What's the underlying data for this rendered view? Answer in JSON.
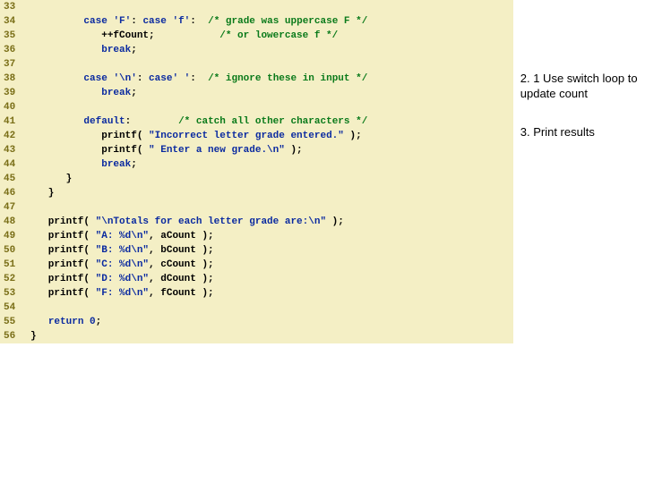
{
  "code_lines": [
    {
      "n": "33",
      "html": ""
    },
    {
      "n": "34",
      "html": "         <span class='kw'>case</span> <span class='ch'>'F'</span>: <span class='kw'>case</span> <span class='ch'>'f'</span>:  <span class='cm'>/* grade was uppercase F */</span>"
    },
    {
      "n": "35",
      "html": "            ++fCount;           <span class='cm'>/* or lowercase f */</span>"
    },
    {
      "n": "36",
      "html": "            <span class='kw'>break</span>;"
    },
    {
      "n": "37",
      "html": ""
    },
    {
      "n": "38",
      "html": "         <span class='kw'>case</span> <span class='ch'>'\\n'</span>: <span class='kw'>case</span><span class='ch'>' '</span>:  <span class='cm'>/* ignore these in input */</span>"
    },
    {
      "n": "39",
      "html": "            <span class='kw'>break</span>;"
    },
    {
      "n": "40",
      "html": ""
    },
    {
      "n": "41",
      "html": "         <span class='kw'>default</span>:        <span class='cm'>/* catch all other characters */</span>"
    },
    {
      "n": "42",
      "html": "            printf( <span class='str'>\"Incorrect letter grade entered.\"</span> );"
    },
    {
      "n": "43",
      "html": "            printf( <span class='str'>\" Enter a new grade.\\n\"</span> );"
    },
    {
      "n": "44",
      "html": "            <span class='kw'>break</span>;"
    },
    {
      "n": "45",
      "html": "      }"
    },
    {
      "n": "46",
      "html": "   }"
    },
    {
      "n": "47",
      "html": ""
    },
    {
      "n": "48",
      "html": "   printf( <span class='str'>\"\\nTotals for each letter grade are:\\n\"</span> );"
    },
    {
      "n": "49",
      "html": "   printf( <span class='str'>\"A: %d\\n\"</span>, aCount );"
    },
    {
      "n": "50",
      "html": "   printf( <span class='str'>\"B: %d\\n\"</span>, bCount );"
    },
    {
      "n": "51",
      "html": "   printf( <span class='str'>\"C: %d\\n\"</span>, cCount );"
    },
    {
      "n": "52",
      "html": "   printf( <span class='str'>\"D: %d\\n\"</span>, dCount );"
    },
    {
      "n": "53",
      "html": "   printf( <span class='str'>\"F: %d\\n\"</span>, fCount );"
    },
    {
      "n": "54",
      "html": ""
    },
    {
      "n": "55",
      "html": "   <span class='kw'>return</span> <span class='ch'>0</span>;"
    },
    {
      "n": "56",
      "html": "}"
    }
  ],
  "notes": {
    "n1": "2. 1  Use switch loop to update count",
    "n2": "3.  Print results"
  }
}
